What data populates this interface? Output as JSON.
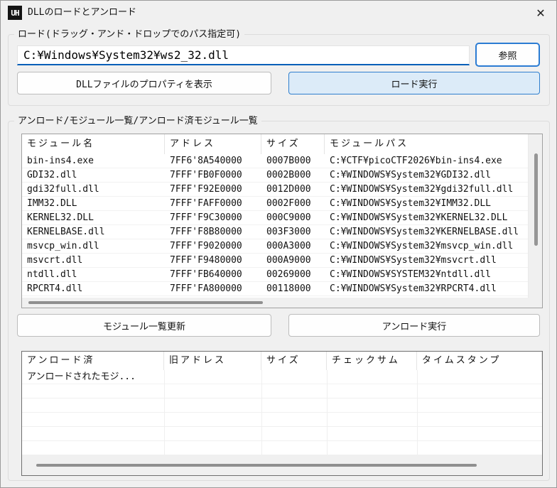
{
  "window": {
    "title": "DLLのロードとアンロード",
    "app_icon_text": "UH",
    "close_glyph": "✕"
  },
  "load_group": {
    "label": "ロード(ドラッグ・アンド・ドロップでのパス指定可)",
    "path_value": "C:¥Windows¥System32¥ws2_32.dll",
    "browse_label": "参照",
    "props_label": "DLLファイルのプロパティを表示",
    "load_label": "ロード実行"
  },
  "modules_group": {
    "label": "アンロード/モジュール一覧/アンロード済モジュール一覧",
    "refresh_label": "モジュール一覧更新",
    "unload_label": "アンロード実行",
    "module_table": {
      "headers": [
        "モジュール名",
        "アドレス",
        "サイズ",
        "モジュールパス"
      ],
      "rows": [
        [
          "bin-ins4.exe",
          "7FF6'8A540000",
          "0007B000",
          "C:¥CTF¥picoCTF2026¥bin-ins4.exe"
        ],
        [
          "GDI32.dll",
          "7FFF'FB0F0000",
          "0002B000",
          "C:¥WINDOWS¥System32¥GDI32.dll"
        ],
        [
          "gdi32full.dll",
          "7FFF'F92E0000",
          "0012D000",
          "C:¥WINDOWS¥System32¥gdi32full.dll"
        ],
        [
          "IMM32.DLL",
          "7FFF'FAFF0000",
          "0002F000",
          "C:¥WINDOWS¥System32¥IMM32.DLL"
        ],
        [
          "KERNEL32.DLL",
          "7FFF'F9C30000",
          "000C9000",
          "C:¥WINDOWS¥System32¥KERNEL32.DLL"
        ],
        [
          "KERNELBASE.dll",
          "7FFF'F8B80000",
          "003F3000",
          "C:¥WINDOWS¥System32¥KERNELBASE.dll"
        ],
        [
          "msvcp_win.dll",
          "7FFF'F9020000",
          "000A3000",
          "C:¥WINDOWS¥System32¥msvcp_win.dll"
        ],
        [
          "msvcrt.dll",
          "7FFF'F9480000",
          "000A9000",
          "C:¥WINDOWS¥System32¥msvcrt.dll"
        ],
        [
          "ntdll.dll",
          "7FFF'FB640000",
          "00269000",
          "C:¥WINDOWS¥SYSTEM32¥ntdll.dll"
        ],
        [
          "RPCRT4.dll",
          "7FFF'FA800000",
          "00118000",
          "C:¥WINDOWS¥System32¥RPCRT4.dll"
        ]
      ]
    },
    "unloaded_table": {
      "headers": [
        "アンロード済",
        "旧アドレス",
        "サイズ",
        "チェックサム",
        "タイムスタンプ"
      ],
      "rows": [
        [
          "アンロードされたモジ...",
          "",
          "",
          "",
          ""
        ]
      ]
    }
  },
  "colors": {
    "accent_underline": "#005fb8",
    "accent_button_bg": "#dcebf8",
    "accent_button_border": "#2f7fce",
    "window_bg": "#f0f0f0"
  }
}
